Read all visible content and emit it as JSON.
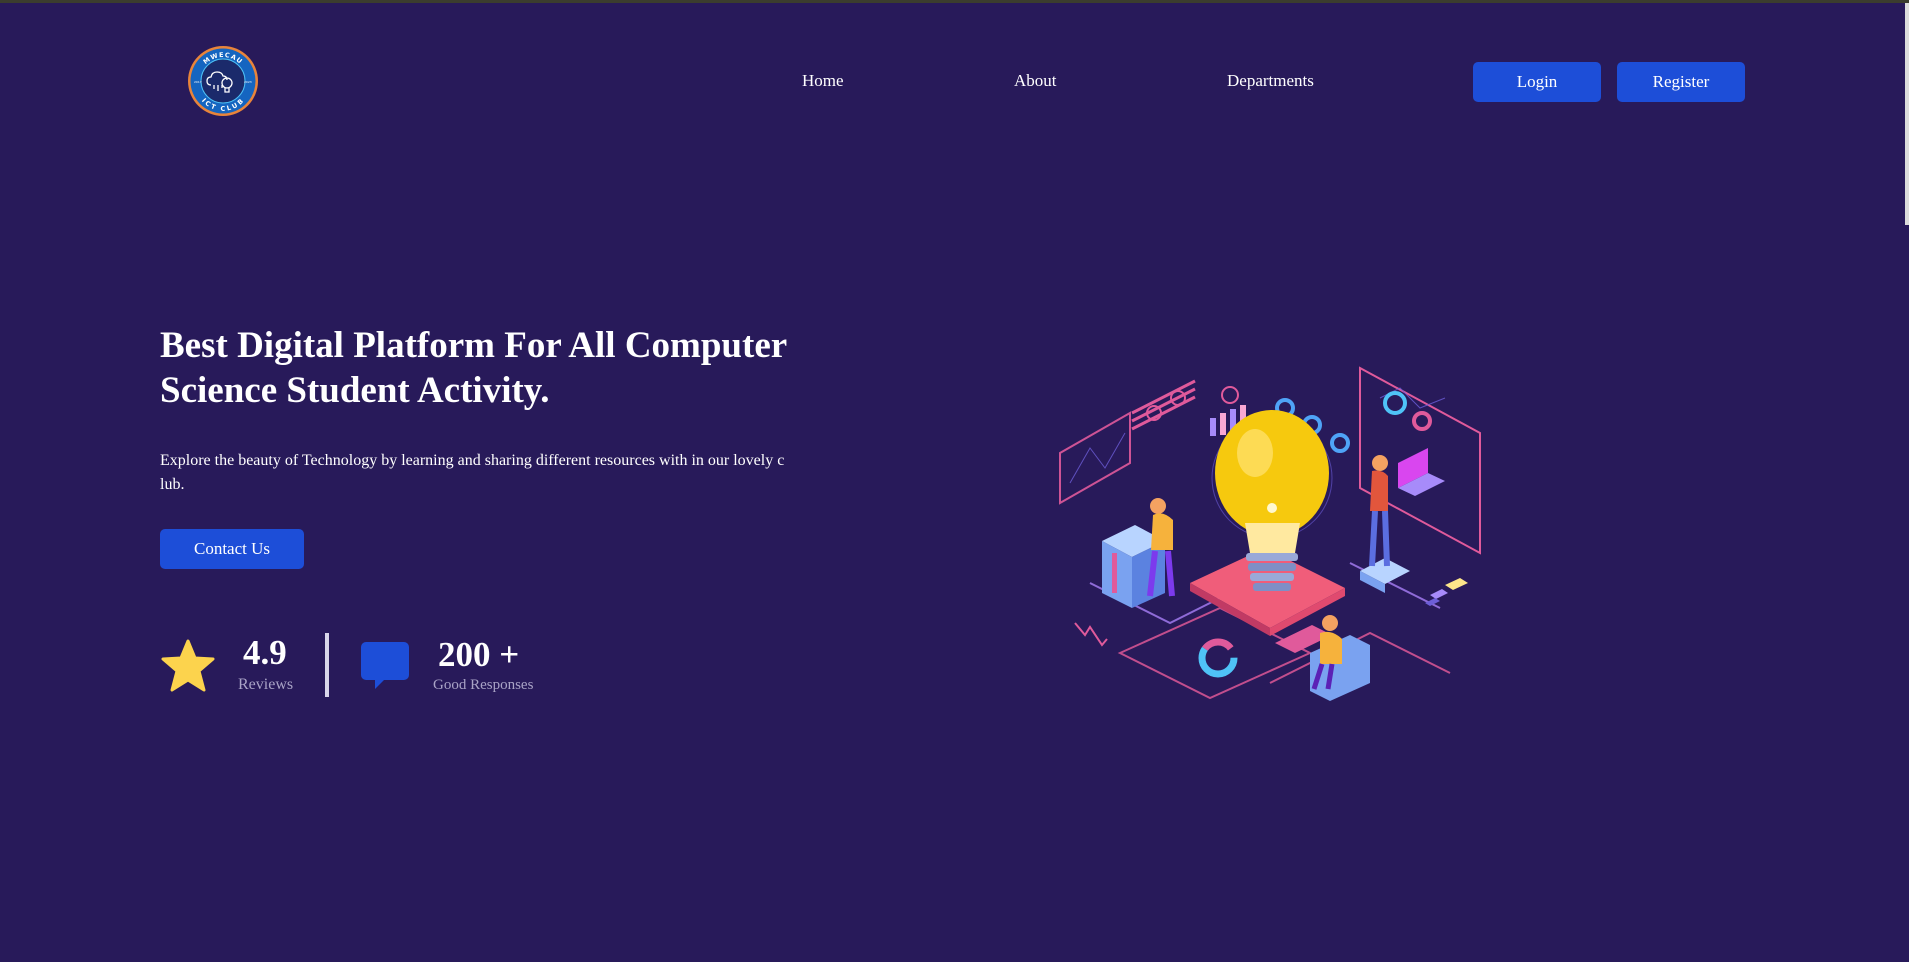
{
  "header": {
    "logo": {
      "ring_top": "MWECAU",
      "ring_bottom": "ICT CLUB",
      "left_year": "2017",
      "right_year": "2023"
    },
    "nav": [
      {
        "label": "Home"
      },
      {
        "label": "About"
      },
      {
        "label": "Departments"
      }
    ],
    "login_label": "Login",
    "register_label": "Register"
  },
  "hero": {
    "title": "Best Digital Platform For All Computer Science Student Activity.",
    "description": "Explore the beauty of Technology by learning and sharing different resources with in our lovely club.",
    "cta_label": "Contact Us"
  },
  "stats": [
    {
      "value": "4.9",
      "label": "Reviews",
      "icon": "star-icon"
    },
    {
      "value": "200 +",
      "label": "Good Responses",
      "icon": "chat-bubble-icon"
    }
  ],
  "colors": {
    "background": "#281a5a",
    "primary": "#1d4ed8",
    "star": "#fcd34d",
    "muted_text": "#a9a3c6"
  }
}
